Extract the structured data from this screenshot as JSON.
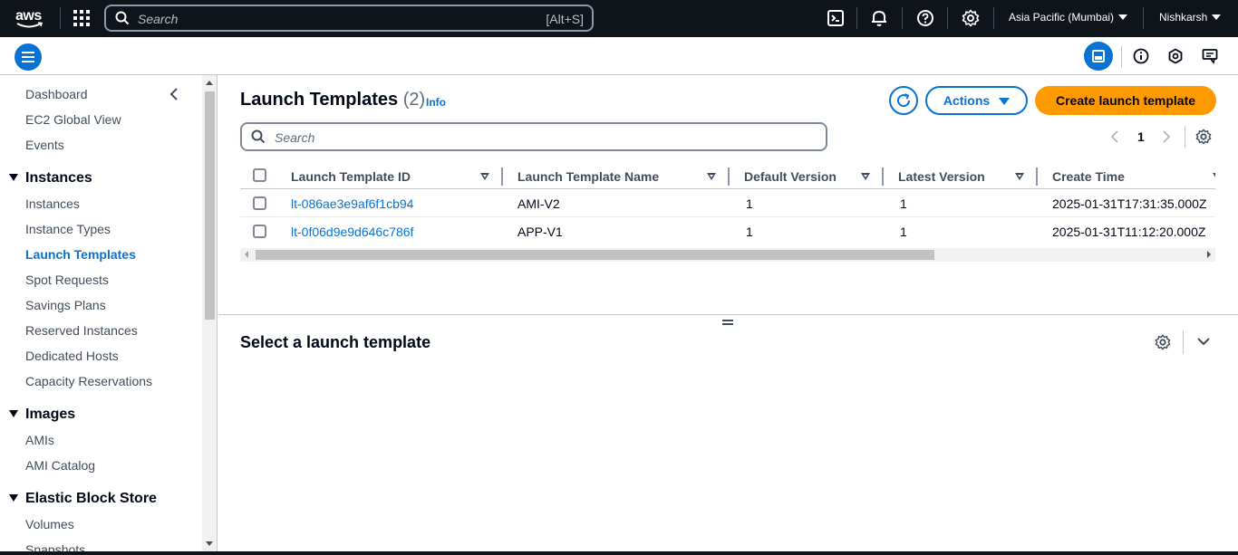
{
  "topbar": {
    "logo_text": "aws",
    "search_placeholder": "Search",
    "search_shortcut": "[Alt+S]",
    "region": "Asia Pacific (Mumbai)",
    "user": "Nishkarsh",
    "icons": [
      "cloudshell-icon",
      "bell-icon",
      "help-icon",
      "gear-icon"
    ]
  },
  "sidebar": {
    "top_items": [
      "Dashboard",
      "EC2 Global View",
      "Events"
    ],
    "sections": [
      {
        "title": "Instances",
        "items": [
          "Instances",
          "Instance Types",
          "Launch Templates",
          "Spot Requests",
          "Savings Plans",
          "Reserved Instances",
          "Dedicated Hosts",
          "Capacity Reservations"
        ]
      },
      {
        "title": "Images",
        "items": [
          "AMIs",
          "AMI Catalog"
        ]
      },
      {
        "title": "Elastic Block Store",
        "items": [
          "Volumes",
          "Snapshots"
        ]
      }
    ],
    "active_item": "Launch Templates"
  },
  "main": {
    "title": "Launch Templates",
    "count": "(2)",
    "info": "Info",
    "actions_label": "Actions",
    "create_label": "Create launch template",
    "search_placeholder": "Search",
    "page": "1",
    "columns": [
      "Launch Template ID",
      "Launch Template Name",
      "Default Version",
      "Latest Version",
      "Create Time"
    ],
    "rows": [
      {
        "id": "lt-086ae3e9af6f1cb94",
        "name": "AMI-V2",
        "default_version": "1",
        "latest_version": "1",
        "create_time": "2025-01-31T17:31:35.000Z"
      },
      {
        "id": "lt-0f06d9e9d646c786f",
        "name": "APP-V1",
        "default_version": "1",
        "latest_version": "1",
        "create_time": "2025-01-31T11:12:20.000Z"
      }
    ]
  },
  "detail": {
    "title": "Select a launch template"
  },
  "colors": {
    "topbar": "#0f141a",
    "accent": "#0972d3",
    "primary_button": "#ff9900"
  }
}
